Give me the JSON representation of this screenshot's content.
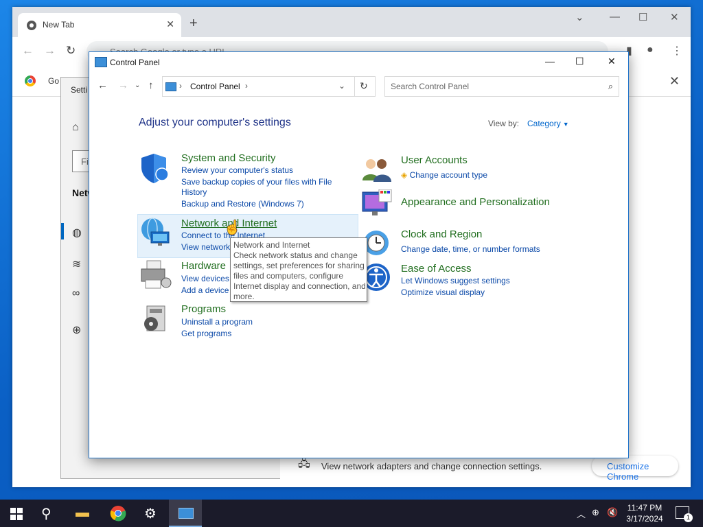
{
  "chrome": {
    "tab_title": "New Tab",
    "omnibox_placeholder": "Search Google or type a URL",
    "bookmark_label": "Go",
    "customize_label": "Customize Chrome"
  },
  "settings": {
    "title": "Setti",
    "find_placeholder": "Fi",
    "section": "Netw",
    "adapter_text": "View network adapters and change connection settings."
  },
  "control_panel": {
    "title": "Control Panel",
    "breadcrumb": "Control Panel",
    "search_placeholder": "Search Control Panel",
    "heading": "Adjust your computer's settings",
    "view_by_label": "View by:",
    "view_by_value": "Category",
    "categories": {
      "system": {
        "title": "System and Security",
        "links": [
          "Review your computer's status",
          "Save backup copies of your files with File",
          "History",
          "Backup and Restore (Windows 7)"
        ]
      },
      "network": {
        "title": "Network and Internet",
        "links": [
          "Connect to the Internet",
          "View network"
        ]
      },
      "hardware": {
        "title": "Hardware",
        "links": [
          "View devices",
          "Add a device"
        ]
      },
      "programs": {
        "title": "Programs",
        "links": [
          "Uninstall a program",
          "Get programs"
        ]
      },
      "user_accounts": {
        "title": "User Accounts",
        "links": [
          "Change account type"
        ]
      },
      "appearance": {
        "title": "Appearance and Personalization"
      },
      "clock": {
        "title": "Clock and Region",
        "links": [
          "Change date, time, or number formats"
        ]
      },
      "ease": {
        "title": "Ease of Access",
        "links": [
          "Let Windows suggest settings",
          "Optimize visual display"
        ]
      }
    },
    "tooltip": {
      "lines": [
        "Network and Internet",
        "Check network status and change",
        "settings, set preferences for sharing",
        "files and computers, configure",
        "Internet display and connection, and",
        "more."
      ]
    }
  },
  "taskbar": {
    "time": "11:47 PM",
    "date": "3/17/2024",
    "notification_count": "1"
  },
  "colors": {
    "category_title": "#216e1f",
    "link": "#0b49a8",
    "heading": "#1e3287",
    "taskbar": "#1b1b2a"
  }
}
